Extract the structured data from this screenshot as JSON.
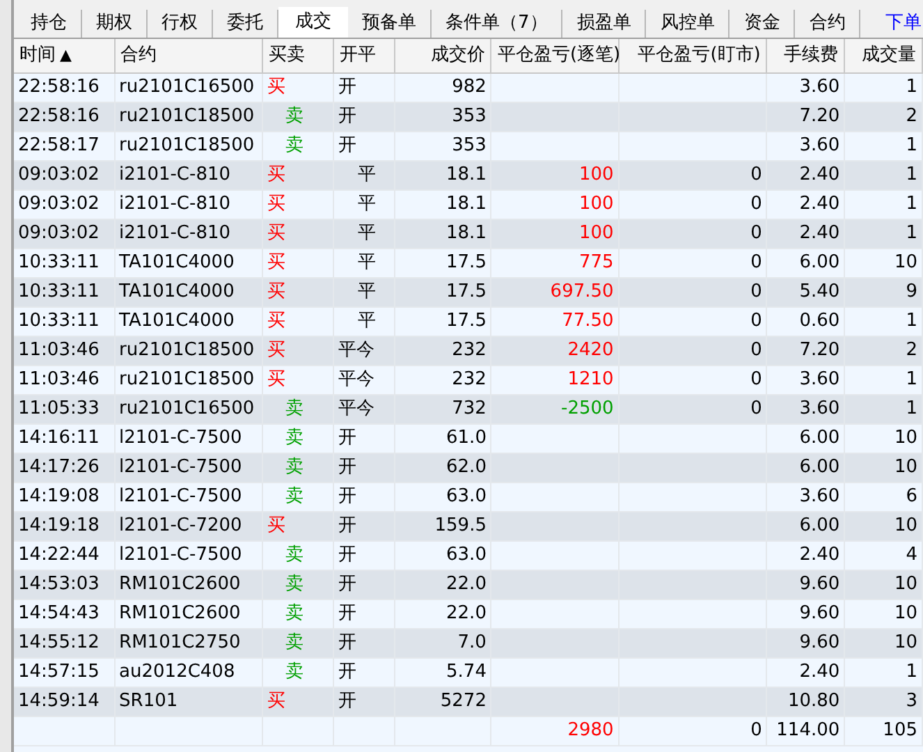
{
  "tabs": [
    {
      "label": "持仓",
      "selected": false
    },
    {
      "label": "期权",
      "selected": false
    },
    {
      "label": "行权",
      "selected": false
    },
    {
      "label": "委托",
      "selected": false
    },
    {
      "label": "成交",
      "selected": true
    },
    {
      "label": "预备单",
      "selected": false
    },
    {
      "label": "条件单（7）",
      "selected": false
    },
    {
      "label": "损盈单",
      "selected": false
    },
    {
      "label": "风控单",
      "selected": false
    },
    {
      "label": "资金",
      "selected": false
    },
    {
      "label": "合约",
      "selected": false
    }
  ],
  "order_link": "下单",
  "table": {
    "columns": [
      {
        "label": "时间",
        "sort_icon": "▲"
      },
      {
        "label": "合约"
      },
      {
        "label": "买卖"
      },
      {
        "label": "开平"
      },
      {
        "label": "成交价"
      },
      {
        "label": "平仓盈亏(逐笔)"
      },
      {
        "label": "平仓盈亏(盯市)"
      },
      {
        "label": "手续费"
      },
      {
        "label": "成交量"
      }
    ],
    "rows": [
      {
        "time": "22:58:16",
        "contract": "ru2101C16500",
        "side": {
          "text": "买",
          "kind": "buy"
        },
        "offset": {
          "text": "开",
          "kind": "open"
        },
        "price": "982",
        "fee": "3.60",
        "volume": "1"
      },
      {
        "time": "22:58:16",
        "contract": "ru2101C18500",
        "side": {
          "text": "卖",
          "kind": "sell"
        },
        "offset": {
          "text": "开",
          "kind": "open"
        },
        "price": "353",
        "fee": "7.20",
        "volume": "2"
      },
      {
        "time": "22:58:17",
        "contract": "ru2101C18500",
        "side": {
          "text": "卖",
          "kind": "sell"
        },
        "offset": {
          "text": "开",
          "kind": "open"
        },
        "price": "353",
        "fee": "3.60",
        "volume": "1"
      },
      {
        "time": "09:03:02",
        "contract": "i2101-C-810",
        "side": {
          "text": "买",
          "kind": "buy"
        },
        "offset": {
          "text": "平",
          "kind": "close"
        },
        "price": "18.1",
        "pnl_trade": {
          "text": "100",
          "color": "#ff0000"
        },
        "pnl_mark": "0",
        "fee": "2.40",
        "volume": "1"
      },
      {
        "time": "09:03:02",
        "contract": "i2101-C-810",
        "side": {
          "text": "买",
          "kind": "buy"
        },
        "offset": {
          "text": "平",
          "kind": "close"
        },
        "price": "18.1",
        "pnl_trade": {
          "text": "100",
          "color": "#ff0000"
        },
        "pnl_mark": "0",
        "fee": "2.40",
        "volume": "1"
      },
      {
        "time": "09:03:02",
        "contract": "i2101-C-810",
        "side": {
          "text": "买",
          "kind": "buy"
        },
        "offset": {
          "text": "平",
          "kind": "close"
        },
        "price": "18.1",
        "pnl_trade": {
          "text": "100",
          "color": "#ff0000"
        },
        "pnl_mark": "0",
        "fee": "2.40",
        "volume": "1"
      },
      {
        "time": "10:33:11",
        "contract": "TA101C4000",
        "side": {
          "text": "买",
          "kind": "buy"
        },
        "offset": {
          "text": "平",
          "kind": "close"
        },
        "price": "17.5",
        "pnl_trade": {
          "text": "775",
          "color": "#ff0000"
        },
        "pnl_mark": "0",
        "fee": "6.00",
        "volume": "10"
      },
      {
        "time": "10:33:11",
        "contract": "TA101C4000",
        "side": {
          "text": "买",
          "kind": "buy"
        },
        "offset": {
          "text": "平",
          "kind": "close"
        },
        "price": "17.5",
        "pnl_trade": {
          "text": "697.50",
          "color": "#ff0000"
        },
        "pnl_mark": "0",
        "fee": "5.40",
        "volume": "9"
      },
      {
        "time": "10:33:11",
        "contract": "TA101C4000",
        "side": {
          "text": "买",
          "kind": "buy"
        },
        "offset": {
          "text": "平",
          "kind": "close"
        },
        "price": "17.5",
        "pnl_trade": {
          "text": "77.50",
          "color": "#ff0000"
        },
        "pnl_mark": "0",
        "fee": "0.60",
        "volume": "1"
      },
      {
        "time": "11:03:46",
        "contract": "ru2101C18500",
        "side": {
          "text": "买",
          "kind": "buy"
        },
        "offset": {
          "text": "平今",
          "kind": "close_today"
        },
        "price": "232",
        "pnl_trade": {
          "text": "2420",
          "color": "#ff0000"
        },
        "pnl_mark": "0",
        "fee": "7.20",
        "volume": "2"
      },
      {
        "time": "11:03:46",
        "contract": "ru2101C18500",
        "side": {
          "text": "买",
          "kind": "buy"
        },
        "offset": {
          "text": "平今",
          "kind": "close_today"
        },
        "price": "232",
        "pnl_trade": {
          "text": "1210",
          "color": "#ff0000"
        },
        "pnl_mark": "0",
        "fee": "3.60",
        "volume": "1"
      },
      {
        "time": "11:05:33",
        "contract": "ru2101C16500",
        "side": {
          "text": "卖",
          "kind": "sell"
        },
        "offset": {
          "text": "平今",
          "kind": "close_today"
        },
        "price": "732",
        "pnl_trade": {
          "text": "-2500",
          "color": "#00a000"
        },
        "pnl_mark": "0",
        "fee": "3.60",
        "volume": "1"
      },
      {
        "time": "14:16:11",
        "contract": "l2101-C-7500",
        "side": {
          "text": "卖",
          "kind": "sell"
        },
        "offset": {
          "text": "开",
          "kind": "open"
        },
        "price": "61.0",
        "fee": "6.00",
        "volume": "10"
      },
      {
        "time": "14:17:26",
        "contract": "l2101-C-7500",
        "side": {
          "text": "卖",
          "kind": "sell"
        },
        "offset": {
          "text": "开",
          "kind": "open"
        },
        "price": "62.0",
        "fee": "6.00",
        "volume": "10"
      },
      {
        "time": "14:19:08",
        "contract": "l2101-C-7500",
        "side": {
          "text": "卖",
          "kind": "sell"
        },
        "offset": {
          "text": "开",
          "kind": "open"
        },
        "price": "63.0",
        "fee": "3.60",
        "volume": "6"
      },
      {
        "time": "14:19:18",
        "contract": "l2101-C-7200",
        "side": {
          "text": "买",
          "kind": "buy"
        },
        "offset": {
          "text": "开",
          "kind": "open"
        },
        "price": "159.5",
        "fee": "6.00",
        "volume": "10"
      },
      {
        "time": "14:22:44",
        "contract": "l2101-C-7500",
        "side": {
          "text": "卖",
          "kind": "sell"
        },
        "offset": {
          "text": "开",
          "kind": "open"
        },
        "price": "63.0",
        "fee": "2.40",
        "volume": "4"
      },
      {
        "time": "14:53:03",
        "contract": "RM101C2600",
        "side": {
          "text": "卖",
          "kind": "sell"
        },
        "offset": {
          "text": "开",
          "kind": "open"
        },
        "price": "22.0",
        "fee": "9.60",
        "volume": "10"
      },
      {
        "time": "14:54:43",
        "contract": "RM101C2600",
        "side": {
          "text": "卖",
          "kind": "sell"
        },
        "offset": {
          "text": "开",
          "kind": "open"
        },
        "price": "22.0",
        "fee": "9.60",
        "volume": "10"
      },
      {
        "time": "14:55:12",
        "contract": "RM101C2750",
        "side": {
          "text": "卖",
          "kind": "sell"
        },
        "offset": {
          "text": "开",
          "kind": "open"
        },
        "price": "7.0",
        "fee": "9.60",
        "volume": "10"
      },
      {
        "time": "14:57:15",
        "contract": "au2012C408",
        "side": {
          "text": "卖",
          "kind": "sell"
        },
        "offset": {
          "text": "开",
          "kind": "open"
        },
        "price": "5.74",
        "fee": "2.40",
        "volume": "1"
      },
      {
        "time": "14:59:14",
        "contract": "SR101",
        "side": {
          "text": "买",
          "kind": "buy"
        },
        "offset": {
          "text": "开",
          "kind": "open"
        },
        "price": "5272",
        "fee": "10.80",
        "volume": "3"
      }
    ],
    "totals": {
      "pnl_trade": {
        "text": "2980",
        "color": "#ff0000"
      },
      "pnl_mark": "0",
      "fee": "114.00",
      "volume": "105"
    }
  }
}
